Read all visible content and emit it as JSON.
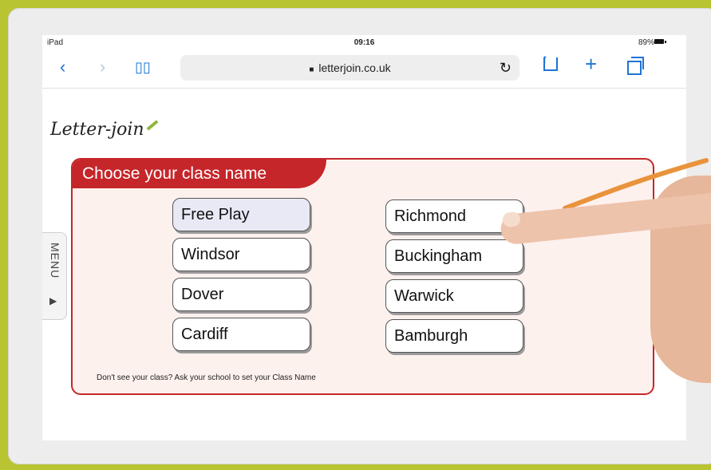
{
  "status_bar": {
    "device": "iPad",
    "time": "09:16",
    "battery": "89%"
  },
  "browser": {
    "address": "letterjoin.co.uk"
  },
  "brand": {
    "logo_text": "Letter-join"
  },
  "panel": {
    "title": "Choose your class name",
    "classes_left": [
      "Free Play",
      "Windsor",
      "Dover",
      "Cardiff"
    ],
    "classes_right": [
      "Richmond",
      "Buckingham",
      "Warwick",
      "Bamburgh"
    ],
    "help_text": "Don't see your class? Ask your school to set your Class Name"
  },
  "menu": {
    "label": "MENU"
  },
  "colors": {
    "frame": "#b8c431",
    "panel_red": "#c5262a",
    "accent_blue": "#1e73d6",
    "annotation_orange": "#e9933c"
  }
}
